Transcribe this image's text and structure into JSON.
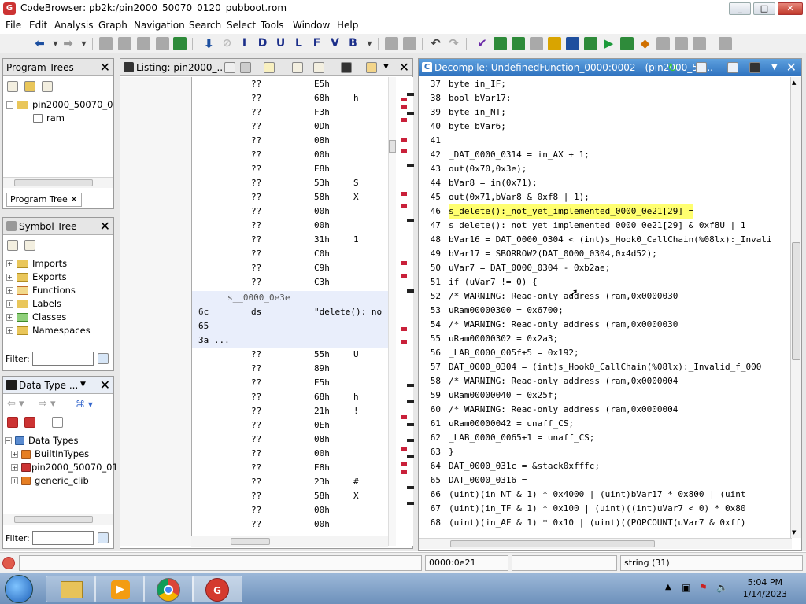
{
  "window": {
    "title": "CodeBrowser: pb2k:/pin2000_50070_0120_pubboot.rom",
    "min": "_",
    "max": "□",
    "close": "✕"
  },
  "menu": [
    "File",
    "Edit",
    "Analysis",
    "Graph",
    "Navigation",
    "Search",
    "Select",
    "Tools",
    "Window",
    "Help"
  ],
  "toolbar": {
    "letters": [
      "I",
      "D",
      "U",
      "L",
      "F",
      "V",
      "B"
    ]
  },
  "program_trees": {
    "title": "Program Trees",
    "root": "pin2000_50070_0",
    "child": "ram",
    "tab": "Program Tree"
  },
  "symbol_tree": {
    "title": "Symbol Tree",
    "items": [
      "Imports",
      "Exports",
      "Functions",
      "Labels",
      "Classes",
      "Namespaces"
    ],
    "filter_label": "Filter:"
  },
  "data_types": {
    "title": "Data Type ...",
    "root": "Data Types",
    "items": [
      "BuiltInTypes",
      "pin2000_50070_01",
      "generic_clib"
    ],
    "filter_label": "Filter:"
  },
  "listing": {
    "title": "Listing: pin2000_...",
    "rows": [
      {
        "op": "??",
        "val": "E5h",
        "ch": ""
      },
      {
        "op": "??",
        "val": "68h",
        "ch": "h"
      },
      {
        "op": "??",
        "val": "F3h",
        "ch": ""
      },
      {
        "op": "??",
        "val": "0Dh",
        "ch": ""
      },
      {
        "op": "??",
        "val": "08h",
        "ch": ""
      },
      {
        "op": "??",
        "val": "00h",
        "ch": ""
      },
      {
        "op": "??",
        "val": "E8h",
        "ch": ""
      },
      {
        "op": "??",
        "val": "53h",
        "ch": "S"
      },
      {
        "op": "??",
        "val": "58h",
        "ch": "X"
      },
      {
        "op": "??",
        "val": "00h",
        "ch": ""
      },
      {
        "op": "??",
        "val": "00h",
        "ch": ""
      },
      {
        "op": "??",
        "val": "31h",
        "ch": "1"
      },
      {
        "op": "??",
        "val": "C0h",
        "ch": ""
      },
      {
        "op": "??",
        "val": "C9h",
        "ch": ""
      },
      {
        "op": "??",
        "val": "C3h",
        "ch": ""
      }
    ],
    "label": "s__0000_0e3e",
    "str_row": {
      "a": "6c",
      "b": "ds",
      "c": "\"delete(): no"
    },
    "str_b": "65",
    "str_c": "3a ...",
    "rows2": [
      {
        "op": "??",
        "val": "55h",
        "ch": "U"
      },
      {
        "op": "??",
        "val": "89h",
        "ch": ""
      },
      {
        "op": "??",
        "val": "E5h",
        "ch": ""
      },
      {
        "op": "??",
        "val": "68h",
        "ch": "h"
      },
      {
        "op": "??",
        "val": "21h",
        "ch": "!"
      },
      {
        "op": "??",
        "val": "0Eh",
        "ch": ""
      },
      {
        "op": "??",
        "val": "08h",
        "ch": ""
      },
      {
        "op": "??",
        "val": "00h",
        "ch": ""
      },
      {
        "op": "??",
        "val": "E8h",
        "ch": ""
      },
      {
        "op": "??",
        "val": "23h",
        "ch": "#"
      },
      {
        "op": "??",
        "val": "58h",
        "ch": "X"
      },
      {
        "op": "??",
        "val": "00h",
        "ch": ""
      },
      {
        "op": "??",
        "val": "00h",
        "ch": ""
      }
    ]
  },
  "decompile": {
    "title": "Decompile: UndefinedFunction_0000:0002 - (pin2000_50...",
    "lines": [
      {
        "n": "37",
        "t": "byte in_IF;"
      },
      {
        "n": "38",
        "t": "bool bVar17;"
      },
      {
        "n": "39",
        "t": "byte in_NT;"
      },
      {
        "n": "40",
        "t": "byte bVar6;"
      },
      {
        "n": "41",
        "t": ""
      },
      {
        "n": "42",
        "t": "_DAT_0000_0314 = in_AX + 1;"
      },
      {
        "n": "43",
        "t": "out(0x70,0x3e);"
      },
      {
        "n": "44",
        "t": "bVar8 = in(0x71);"
      },
      {
        "n": "45",
        "t": "out(0x71,bVar8 & 0xf8 | 1);"
      },
      {
        "n": "46",
        "t": "s_delete():_not_yet_implemented_0000_0e21[29] ="
      },
      {
        "n": "47",
        "t": "     s_delete():_not_yet_implemented_0000_0e21[29] & 0xf8U | 1"
      },
      {
        "n": "48",
        "t": "bVar16 = DAT_0000_0304 < (int)s_Hook0_CallChain(%08lx):_Invali"
      },
      {
        "n": "49",
        "t": "bVar17 = SBORROW2(DAT_0000_0304,0x4d52);"
      },
      {
        "n": "50",
        "t": "uVar7 = DAT_0000_0304 - 0xb2ae;"
      },
      {
        "n": "51",
        "t": "if (uVar7 != 0) {"
      },
      {
        "n": "52",
        "t": "                  /* WARNING: Read-only address (ram,0x0000030"
      },
      {
        "n": "53",
        "t": "  uRam00000300 = 0x6700;"
      },
      {
        "n": "54",
        "t": "                  /* WARNING: Read-only address (ram,0x0000030"
      },
      {
        "n": "55",
        "t": "  uRam00000302 = 0x2a3;"
      },
      {
        "n": "56",
        "t": "  _LAB_0000_005f+5 = 0x192;"
      },
      {
        "n": "57",
        "t": "  DAT_0000_0304 = (int)s_Hook0_CallChain(%08lx):_Invalid_f_000"
      },
      {
        "n": "58",
        "t": "                  /* WARNING: Read-only address (ram,0x0000004"
      },
      {
        "n": "59",
        "t": "  uRam00000040 = 0x25f;"
      },
      {
        "n": "60",
        "t": "                  /* WARNING: Read-only address (ram,0x0000004"
      },
      {
        "n": "61",
        "t": "  uRam00000042 = unaff_CS;"
      },
      {
        "n": "62",
        "t": "  _LAB_0000_0065+1 = unaff_CS;"
      },
      {
        "n": "63",
        "t": "}"
      },
      {
        "n": "64",
        "t": "DAT_0000_031c = &stack0xfffc;"
      },
      {
        "n": "65",
        "t": "DAT_0000_0316 ="
      },
      {
        "n": "66",
        "t": "     (uint)(in_NT & 1) * 0x4000 | (uint)bVar17 * 0x800 | (uint"
      },
      {
        "n": "67",
        "t": "     (uint)(in_TF & 1) * 0x100 | (uint)((int)uVar7 < 0) * 0x80"
      },
      {
        "n": "68",
        "t": "     (uint)(in_AF & 1) * 0x10 | (uint)((POPCOUNT(uVar7 & 0xff)"
      }
    ]
  },
  "status": {
    "address": "0000:0e21",
    "type": "string  (31)"
  },
  "clock": {
    "time": "5:04 PM",
    "date": "1/14/2023"
  },
  "colors": {
    "titleblue": "#2f72bf",
    "highlight": "#ffff70",
    "mark": "#c9203a"
  }
}
